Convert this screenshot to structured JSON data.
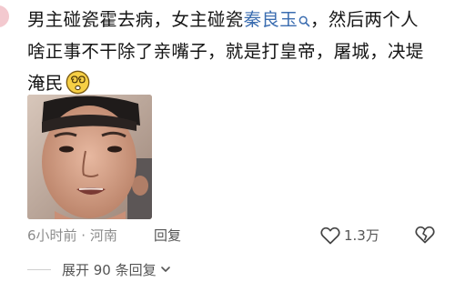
{
  "comment": {
    "line1_before": "男主碰瓷霍去病，女主碰瓷",
    "line1_link": "秦良玉",
    "line1_after": "，然后两个人",
    "line2": "啥正事不干除了亲嘴子，就是打皇帝，屠城，决堤",
    "line3": "淹民",
    "search_icon": "search-icon",
    "emoji_icon": "dizzy-face-emoji"
  },
  "meta": {
    "time_location": "6小时前 · 河南",
    "reply_label": "回复",
    "like_count": "1.3万",
    "like_icon": "heart-outline-icon",
    "dislike_icon": "broken-heart-icon"
  },
  "expand": {
    "label": "展开 90 条回复",
    "icon": "chevron-down-icon"
  },
  "colors": {
    "link": "#3b6db0",
    "meta_text": "#8c8c8c",
    "action_text": "#555555"
  }
}
